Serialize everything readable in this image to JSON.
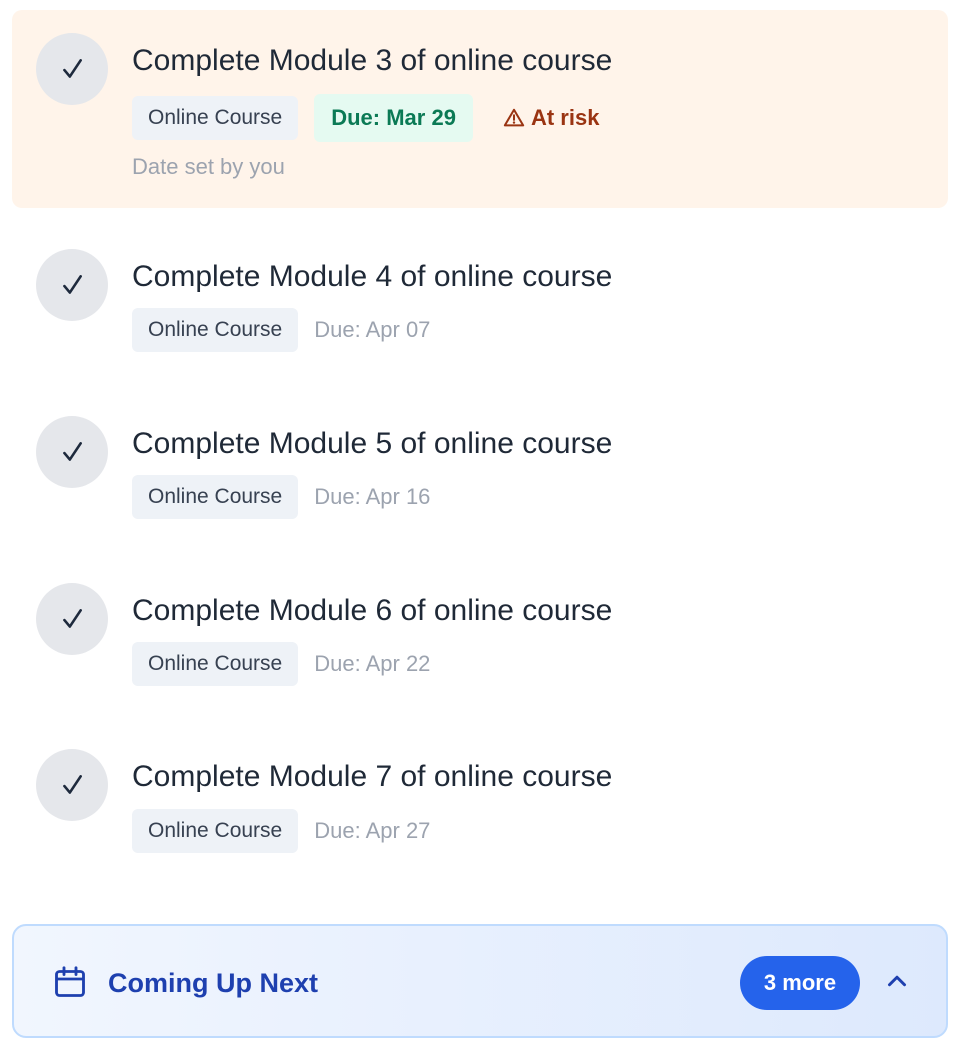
{
  "tasks": [
    {
      "title": "Complete Module 3 of online course",
      "tag": "Online Course",
      "due": "Due: Mar 29",
      "status": "At risk",
      "note": "Date set by you"
    },
    {
      "title": "Complete Module 4 of online course",
      "tag": "Online Course",
      "due": "Due: Apr 07"
    },
    {
      "title": "Complete Module 5 of online course",
      "tag": "Online Course",
      "due": "Due: Apr 16"
    },
    {
      "title": "Complete Module 6 of online course",
      "tag": "Online Course",
      "due": "Due: Apr 22"
    },
    {
      "title": "Complete Module 7 of online course",
      "tag": "Online Course",
      "due": "Due: Apr 27"
    }
  ],
  "footer": {
    "title": "Coming Up Next",
    "count": "3 more"
  },
  "icons": {
    "task_check": "check-icon",
    "risk": "warning-icon",
    "footer": "calendar-icon",
    "toggle": "chevron-up-icon"
  },
  "colors": {
    "highlight_bg": "#fff4ea",
    "due_badge_text": "#0b7a55",
    "risk_text": "#9a3412",
    "accent": "#2563eb",
    "footer_title": "#1e40af"
  }
}
